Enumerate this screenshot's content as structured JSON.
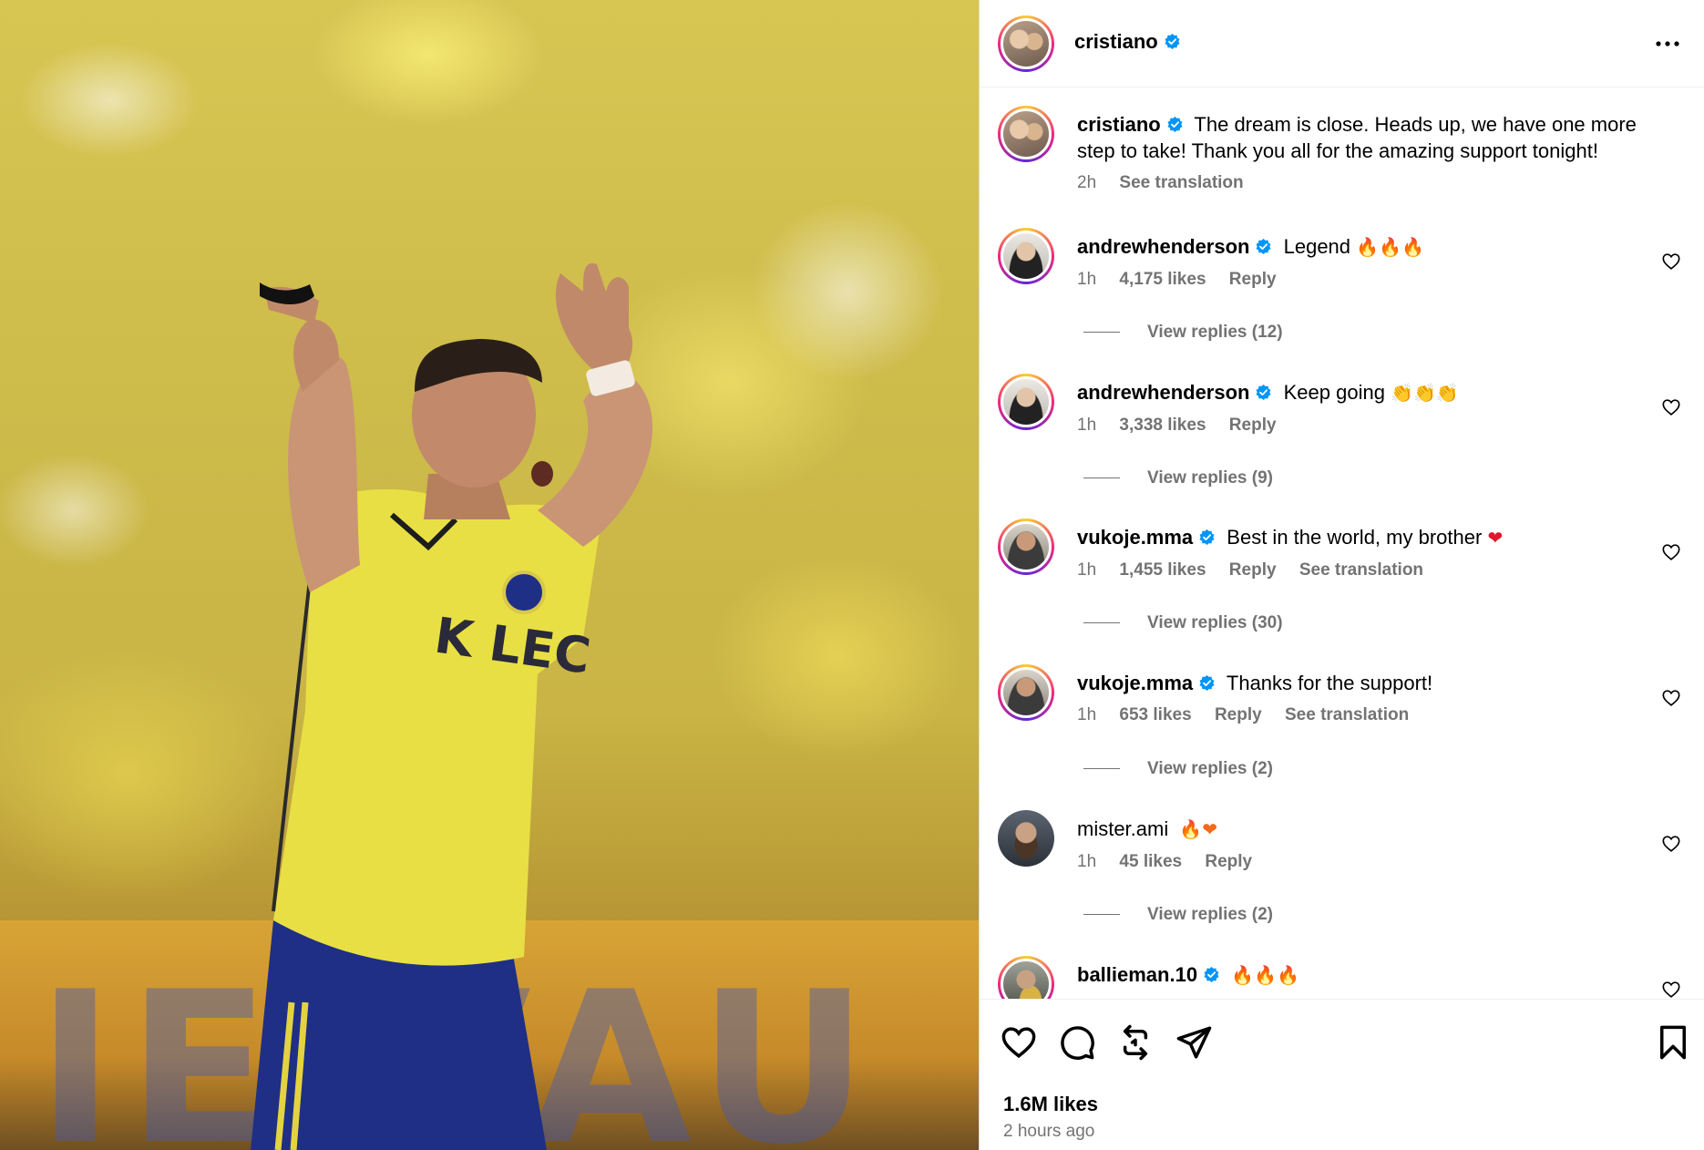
{
  "post": {
    "author": "cristiano",
    "caption": "The dream is close. Heads up, we have one more step to take! Thank you all for the amazing support tonight!",
    "caption_time": "2h",
    "see_translation": "See translation",
    "likes": "1.6M likes",
    "posted": "2 hours ago"
  },
  "comments": [
    {
      "user": "andrewhenderson",
      "text": "Legend",
      "emoji": "🔥🔥🔥",
      "time": "1h",
      "likes": "4,175 likes",
      "reply": "Reply",
      "replies": "View replies (12)"
    },
    {
      "user": "andrewhenderson",
      "text": "Keep going",
      "emoji": "👏👏👏",
      "time": "1h",
      "likes": "3,338 likes",
      "reply": "Reply",
      "replies": "View replies (9)"
    },
    {
      "user": "vukoje.mma",
      "text": "Best in the world, my brother",
      "emoji": "❤",
      "time": "1h",
      "likes": "1,455 likes",
      "reply": "Reply",
      "translation": "See translation",
      "replies": "View replies (30)"
    },
    {
      "user": "vukoje.mma",
      "text": "Thanks for the support!",
      "emoji": "",
      "time": "1h",
      "likes": "653 likes",
      "reply": "Reply",
      "translation": "See translation",
      "replies": "View replies (2)"
    },
    {
      "user": "mister.ami",
      "text": "",
      "emoji": "🔥❤",
      "time": "1h",
      "likes": "45 likes",
      "reply": "Reply",
      "replies": "View replies (2)"
    },
    {
      "user": "ballieman.10",
      "text": "",
      "emoji": "🔥🔥🔥"
    }
  ],
  "icons": {
    "more": "more-options-icon",
    "verified": "verified-badge-icon",
    "like": "heart-icon",
    "comment": "comment-icon",
    "repost": "repost-icon",
    "share": "share-icon",
    "save": "bookmark-icon"
  },
  "colors": {
    "verified": "#0095f6",
    "meta": "#737373"
  }
}
